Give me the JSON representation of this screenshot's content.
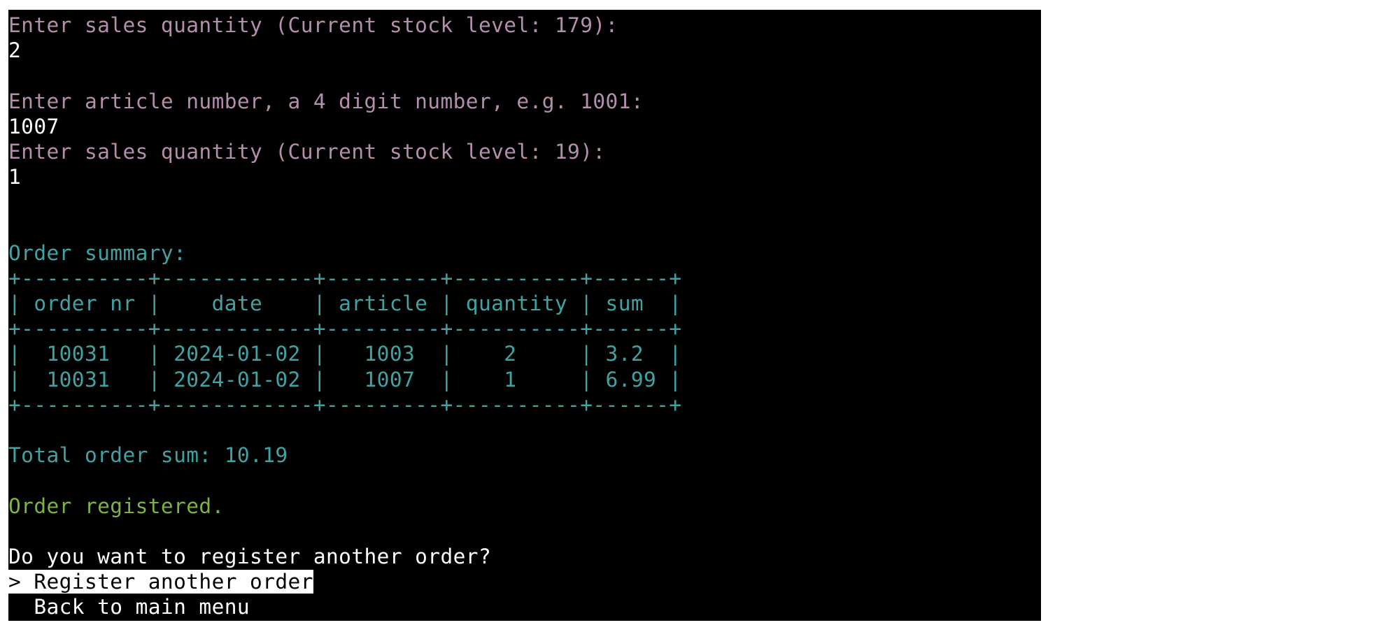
{
  "lines": [
    {
      "text": "Enter sales quantity (Current stock level: 179):"
    },
    {
      "text": "2"
    },
    {
      "text": ""
    },
    {
      "text": "Enter article number, a 4 digit number, e.g. 1001:"
    },
    {
      "text": "1007"
    },
    {
      "text": "Enter sales quantity (Current stock level: 19):"
    },
    {
      "text": "1"
    },
    {
      "text": ""
    },
    {
      "text": ""
    },
    {
      "text": "Order summary:"
    }
  ],
  "table": {
    "border": "+----------+------------+---------+----------+------+",
    "header": "| order nr |    date    | article | quantity | sum  |",
    "rows": [
      "|  10031   | 2024-01-02 |   1003  |    2     | 3.2  |",
      "|  10031   | 2024-01-02 |   1007  |    1     | 6.99 |"
    ]
  },
  "total": "Total order sum: 10.19",
  "status": "Order registered.",
  "question": "Do you want to register another order?",
  "menu": {
    "cursor": "> ",
    "options": [
      "Register another order",
      "Back to main menu"
    ],
    "indent": "  "
  },
  "colors": {
    "prompt": "#b48ead",
    "table": "#3fa3a3",
    "success": "#7cb342",
    "background": "#000000"
  }
}
